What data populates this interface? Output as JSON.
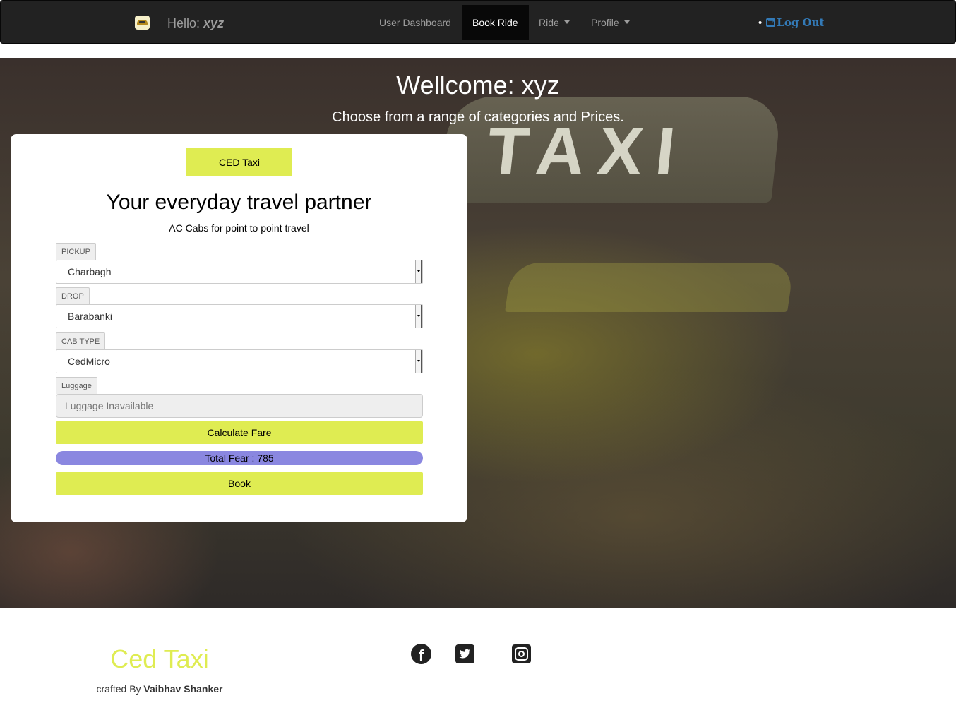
{
  "navbar": {
    "hello_prefix": "Hello:",
    "user": "xyz",
    "links": [
      {
        "label": "User Dashboard"
      },
      {
        "label": "Book Ride"
      },
      {
        "label": "Ride"
      },
      {
        "label": "Profile"
      }
    ],
    "logout_label": "Log Out"
  },
  "hero": {
    "title": "Wellcome: xyz",
    "subtitle": "Choose from a range of categories and Prices."
  },
  "card": {
    "brand_button": "CED Taxi",
    "title": "Your everyday travel partner",
    "subtitle": "AC Cabs for point to point travel",
    "pickup": {
      "label": "PICKUP",
      "value": "Charbagh"
    },
    "drop": {
      "label": "DROP",
      "value": "Barabanki"
    },
    "cab_type": {
      "label": "CAB TYPE",
      "value": "CedMicro"
    },
    "luggage": {
      "label": "Luggage",
      "placeholder": "Luggage Inavailable"
    },
    "calculate_button": "Calculate Fare",
    "total_fare": "Total Fear : 785",
    "book_button": "Book"
  },
  "footer": {
    "brand": "Ced Taxi",
    "credit_prefix": "crafted By",
    "credit_name": "Vaibhav Shanker"
  },
  "colors": {
    "accent": "#dfec52",
    "fare_bar": "#8a87e0",
    "navbar": "#222222",
    "logout_link": "#337ab7"
  },
  "icons": [
    "logo-icon",
    "caret-down-icon",
    "logout-icon",
    "facebook-icon",
    "twitter-icon",
    "instagram-icon"
  ]
}
